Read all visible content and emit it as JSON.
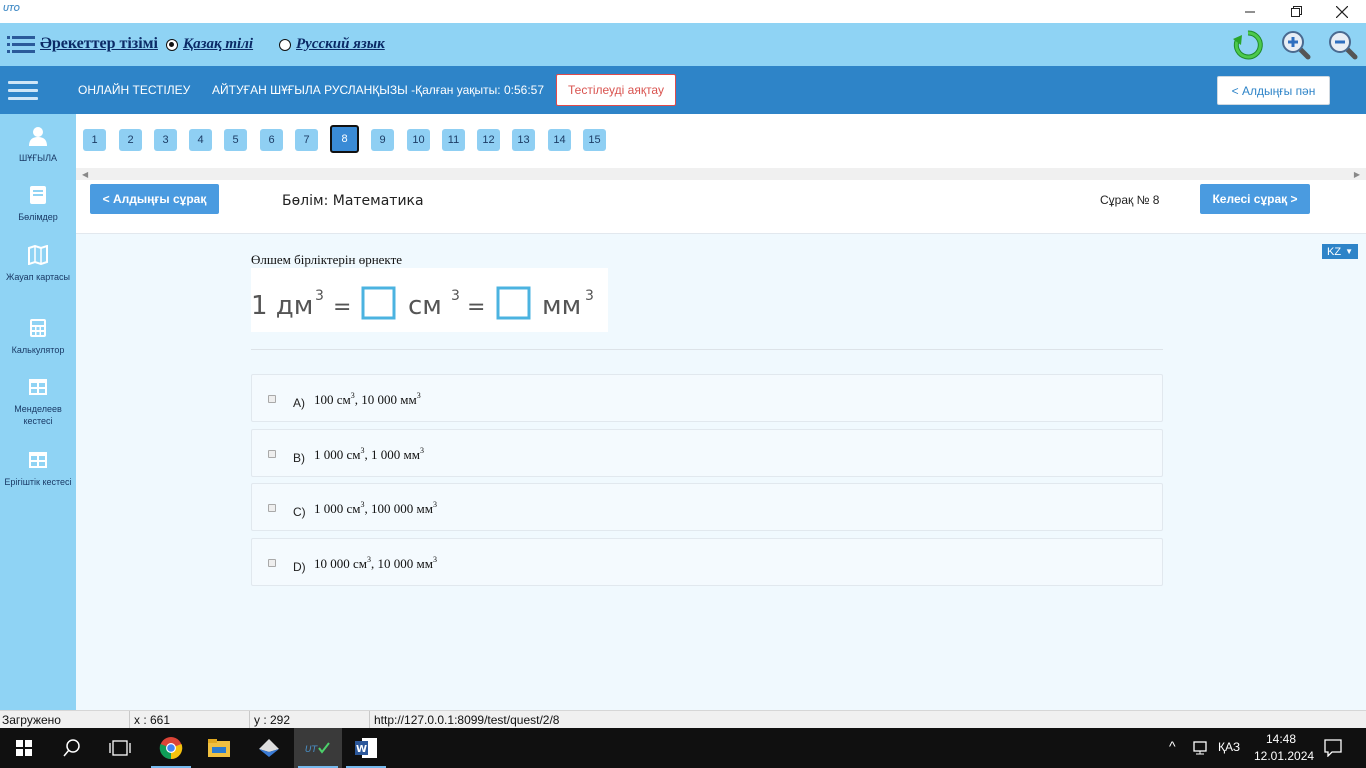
{
  "window": {
    "app_logo": "UTO",
    "min_icon": "minimize-icon",
    "max_icon": "restore-icon",
    "close_icon": "close-icon"
  },
  "toolbar": {
    "title": "Әрекеттер тізімі",
    "lang_kz": "Қазақ тілі",
    "lang_ru": "Русский язык",
    "selected_lang": "kz",
    "icons": [
      "refresh-icon",
      "zoom-in-icon",
      "zoom-out-icon"
    ]
  },
  "nav": {
    "online_test": "ОНЛАЙН ТЕСТІЛЕУ",
    "student_time": "АЙТУҒАН ШҰҒЫЛА РУСЛАНҚЫЗЫ -Қалған уақыты: 0:56:57",
    "finish_button": "Тестілеуді аяқтау",
    "prev_subject_button": "< Алдыңғы пән"
  },
  "sidebar": {
    "items": [
      {
        "label": "ШҰҒЫЛА",
        "icon": "user-icon"
      },
      {
        "label": "Бөлімдер",
        "icon": "book-icon"
      },
      {
        "label": "Жауап картасы",
        "icon": "map-icon"
      },
      {
        "label": "Калькулятор",
        "icon": "calculator-icon"
      },
      {
        "label": "Менделеев кестесі",
        "icon": "table-icon"
      },
      {
        "label": "Ерігіштік кестесі",
        "icon": "table-icon"
      }
    ]
  },
  "question_numbers": [
    "1",
    "2",
    "3",
    "4",
    "5",
    "6",
    "7",
    "8",
    "9",
    "10",
    "11",
    "12",
    "13",
    "14",
    "15"
  ],
  "active_question": "8",
  "header": {
    "prev_question": "< Алдыңғы сұрақ",
    "section": "Бөлім: Математика",
    "counter": "Сұрақ № 8",
    "next_question": "Келесі сұрақ >",
    "lang": "KZ"
  },
  "question": {
    "text": "Өлшем бірліктерін өрнекте",
    "formula": {
      "left": "1 дм",
      "mid": "см",
      "right": "мм",
      "exp": "3",
      "eq": "="
    },
    "colors": {
      "box": "#4bb3e0",
      "text": "#555555"
    }
  },
  "options": [
    {
      "letter": "A)",
      "value1": "100 см",
      "value2": ", 10 000 мм",
      "sup": "3"
    },
    {
      "letter": "B)",
      "value1": "1 000 см",
      "value2": ", 1 000 мм",
      "sup": "3"
    },
    {
      "letter": "C)",
      "value1": "1 000 см",
      "value2": ", 100 000 мм",
      "sup": "3"
    },
    {
      "letter": "D)",
      "value1": "10 000 см",
      "value2": ", 10 000 мм",
      "sup": "3"
    }
  ],
  "status": {
    "state": "Загружено",
    "x": "x : 661",
    "y": "y : 292",
    "url": "http://127.0.0.1:8099/test/quest/2/8"
  },
  "taskbar": {
    "lang": "ҚАЗ",
    "time": "14:48",
    "date": "12.01.2024"
  }
}
